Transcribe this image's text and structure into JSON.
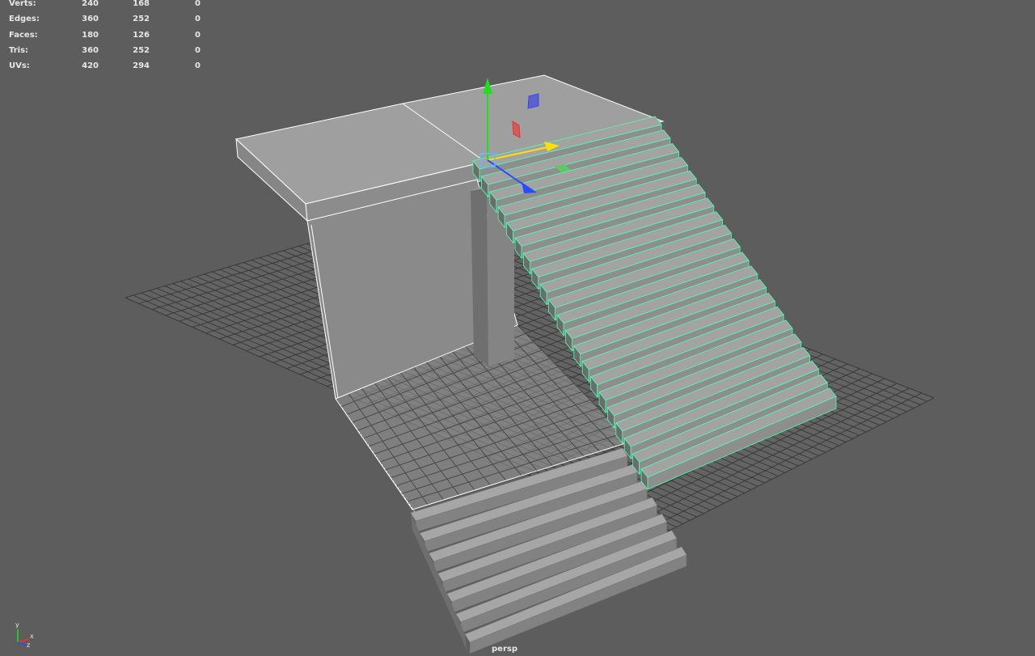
{
  "hud": {
    "rows": [
      {
        "label": "Verts:",
        "v1": "240",
        "v2": "168",
        "v3": "0"
      },
      {
        "label": "Edges:",
        "v1": "360",
        "v2": "252",
        "v3": "0"
      },
      {
        "label": "Faces:",
        "v1": "180",
        "v2": "126",
        "v3": "0"
      },
      {
        "label": "Tris:",
        "v1": "360",
        "v2": "252",
        "v3": "0"
      },
      {
        "label": "UVs:",
        "v1": "420",
        "v2": "294",
        "v3": "0"
      }
    ]
  },
  "viewport": {
    "camera": "persp",
    "background": "#5d5d5d",
    "grid_color": "#3a3a3a",
    "selection_color": "#4dffb0",
    "axis_labels": {
      "y": "y",
      "x": "x",
      "z": "z"
    },
    "colors": {
      "x_axis": "#ff2a2a",
      "y_axis": "#22dd22",
      "z_axis": "#2a4cff",
      "transform_x": "#ffe000"
    }
  }
}
